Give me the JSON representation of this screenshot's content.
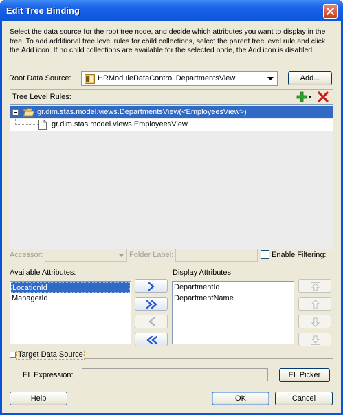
{
  "window": {
    "title": "Edit Tree Binding"
  },
  "description": "Select the data source for the root tree node, and decide which attributes you want to display in the tree. To add additional tree level rules for child collections, select the parent tree level rule and click the Add icon. If no child collections are available for the selected node, the Add icon is disabled.",
  "root_source": {
    "label": "Root Data Source:",
    "value": "HRModuleDataControl.DepartmentsView",
    "add_button": "Add..."
  },
  "tree_rules": {
    "label": "Tree Level Rules:",
    "nodes": [
      {
        "text": "gr.dim.stas.model.views.DepartmentsView(<EmployeesView>)",
        "selected": true
      },
      {
        "text": "gr.dim.stas.model.views.EmployeesView",
        "selected": false
      }
    ]
  },
  "accessor": {
    "label": "Accessor:",
    "folder_label": "Folder Label:",
    "enable_filtering": "Enable Filtering:"
  },
  "available": {
    "label": "Available Attributes:",
    "items": [
      "LocationId",
      "ManagerId"
    ]
  },
  "display": {
    "label": "Display Attributes:",
    "items": [
      "DepartmentId",
      "DepartmentName"
    ]
  },
  "target": {
    "label": "Target Data Source"
  },
  "el": {
    "label": "EL Expression:",
    "value": "",
    "picker_button": "EL Picker"
  },
  "footer": {
    "help": "Help",
    "ok": "OK",
    "cancel": "Cancel"
  },
  "colors": {
    "titlebar": "#0b55db",
    "selection": "#316ac5",
    "dialog_bg": "#ece9d8"
  }
}
